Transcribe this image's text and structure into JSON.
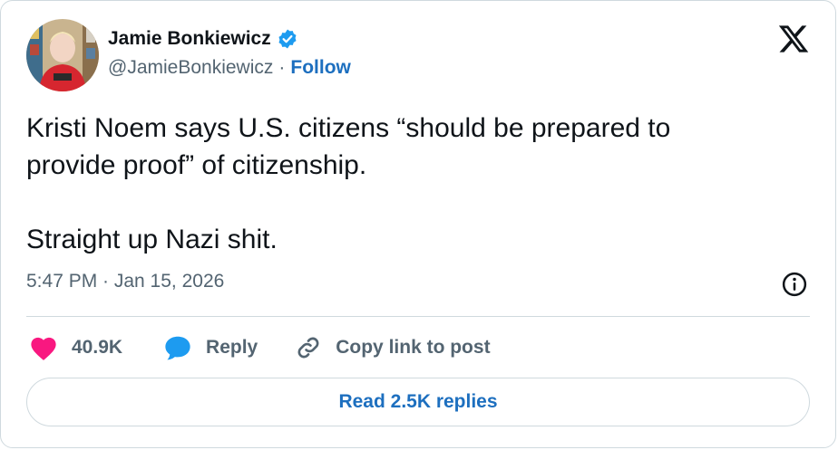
{
  "author": {
    "display_name": "Jamie Bonkiewicz",
    "handle": "@JamieBonkiewicz",
    "separator": "·",
    "follow_label": "Follow",
    "verified": true
  },
  "tweet": {
    "text": "Kristi Noem says U.S. citizens “should be prepared to\nprovide proof” of citizenship.\n\nStraight up Nazi shit.",
    "timestamp": "5:47 PM · Jan 15, 2026"
  },
  "actions": {
    "likes": "40.9K",
    "reply_label": "Reply",
    "copy_link_label": "Copy link to post"
  },
  "replies_button": {
    "label": "Read 2.5K replies"
  },
  "colors": {
    "text": "#0f1419",
    "muted": "#536471",
    "link": "#1d6fbf",
    "like": "#f91880",
    "reply_icon": "#1d9bf0",
    "verified": "#1d9bf0",
    "border": "#cfd9de"
  },
  "icons": {
    "verified": "verified-badge-icon",
    "brand": "x-logo-icon",
    "info": "info-icon",
    "like": "heart-icon",
    "reply": "speech-bubble-icon",
    "copy": "link-icon"
  }
}
